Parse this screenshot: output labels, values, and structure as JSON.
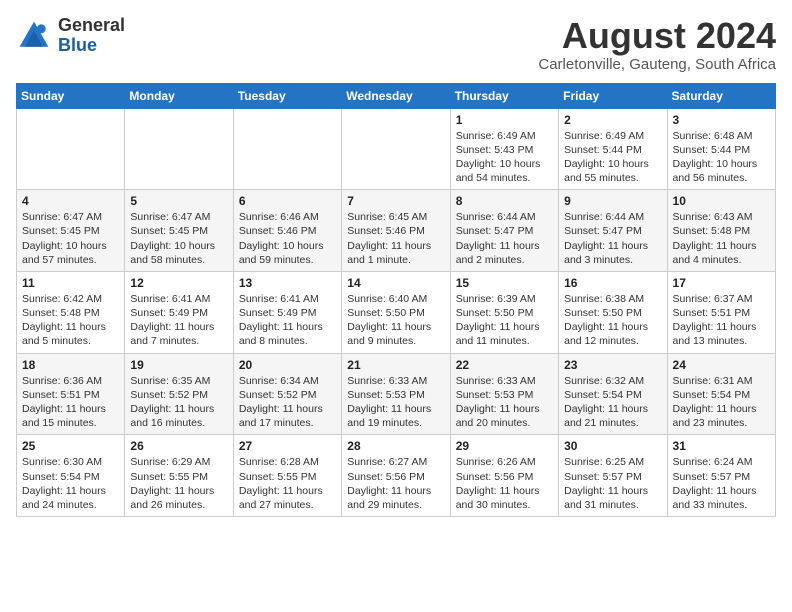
{
  "header": {
    "logo_general": "General",
    "logo_blue": "Blue",
    "month_title": "August 2024",
    "subtitle": "Carletonville, Gauteng, South Africa"
  },
  "days_of_week": [
    "Sunday",
    "Monday",
    "Tuesday",
    "Wednesday",
    "Thursday",
    "Friday",
    "Saturday"
  ],
  "weeks": [
    [
      {
        "day": "",
        "info": ""
      },
      {
        "day": "",
        "info": ""
      },
      {
        "day": "",
        "info": ""
      },
      {
        "day": "",
        "info": ""
      },
      {
        "day": "1",
        "info": "Sunrise: 6:49 AM\nSunset: 5:43 PM\nDaylight: 10 hours and 54 minutes."
      },
      {
        "day": "2",
        "info": "Sunrise: 6:49 AM\nSunset: 5:44 PM\nDaylight: 10 hours and 55 minutes."
      },
      {
        "day": "3",
        "info": "Sunrise: 6:48 AM\nSunset: 5:44 PM\nDaylight: 10 hours and 56 minutes."
      }
    ],
    [
      {
        "day": "4",
        "info": "Sunrise: 6:47 AM\nSunset: 5:45 PM\nDaylight: 10 hours and 57 minutes."
      },
      {
        "day": "5",
        "info": "Sunrise: 6:47 AM\nSunset: 5:45 PM\nDaylight: 10 hours and 58 minutes."
      },
      {
        "day": "6",
        "info": "Sunrise: 6:46 AM\nSunset: 5:46 PM\nDaylight: 10 hours and 59 minutes."
      },
      {
        "day": "7",
        "info": "Sunrise: 6:45 AM\nSunset: 5:46 PM\nDaylight: 11 hours and 1 minute."
      },
      {
        "day": "8",
        "info": "Sunrise: 6:44 AM\nSunset: 5:47 PM\nDaylight: 11 hours and 2 minutes."
      },
      {
        "day": "9",
        "info": "Sunrise: 6:44 AM\nSunset: 5:47 PM\nDaylight: 11 hours and 3 minutes."
      },
      {
        "day": "10",
        "info": "Sunrise: 6:43 AM\nSunset: 5:48 PM\nDaylight: 11 hours and 4 minutes."
      }
    ],
    [
      {
        "day": "11",
        "info": "Sunrise: 6:42 AM\nSunset: 5:48 PM\nDaylight: 11 hours and 5 minutes."
      },
      {
        "day": "12",
        "info": "Sunrise: 6:41 AM\nSunset: 5:49 PM\nDaylight: 11 hours and 7 minutes."
      },
      {
        "day": "13",
        "info": "Sunrise: 6:41 AM\nSunset: 5:49 PM\nDaylight: 11 hours and 8 minutes."
      },
      {
        "day": "14",
        "info": "Sunrise: 6:40 AM\nSunset: 5:50 PM\nDaylight: 11 hours and 9 minutes."
      },
      {
        "day": "15",
        "info": "Sunrise: 6:39 AM\nSunset: 5:50 PM\nDaylight: 11 hours and 11 minutes."
      },
      {
        "day": "16",
        "info": "Sunrise: 6:38 AM\nSunset: 5:50 PM\nDaylight: 11 hours and 12 minutes."
      },
      {
        "day": "17",
        "info": "Sunrise: 6:37 AM\nSunset: 5:51 PM\nDaylight: 11 hours and 13 minutes."
      }
    ],
    [
      {
        "day": "18",
        "info": "Sunrise: 6:36 AM\nSunset: 5:51 PM\nDaylight: 11 hours and 15 minutes."
      },
      {
        "day": "19",
        "info": "Sunrise: 6:35 AM\nSunset: 5:52 PM\nDaylight: 11 hours and 16 minutes."
      },
      {
        "day": "20",
        "info": "Sunrise: 6:34 AM\nSunset: 5:52 PM\nDaylight: 11 hours and 17 minutes."
      },
      {
        "day": "21",
        "info": "Sunrise: 6:33 AM\nSunset: 5:53 PM\nDaylight: 11 hours and 19 minutes."
      },
      {
        "day": "22",
        "info": "Sunrise: 6:33 AM\nSunset: 5:53 PM\nDaylight: 11 hours and 20 minutes."
      },
      {
        "day": "23",
        "info": "Sunrise: 6:32 AM\nSunset: 5:54 PM\nDaylight: 11 hours and 21 minutes."
      },
      {
        "day": "24",
        "info": "Sunrise: 6:31 AM\nSunset: 5:54 PM\nDaylight: 11 hours and 23 minutes."
      }
    ],
    [
      {
        "day": "25",
        "info": "Sunrise: 6:30 AM\nSunset: 5:54 PM\nDaylight: 11 hours and 24 minutes."
      },
      {
        "day": "26",
        "info": "Sunrise: 6:29 AM\nSunset: 5:55 PM\nDaylight: 11 hours and 26 minutes."
      },
      {
        "day": "27",
        "info": "Sunrise: 6:28 AM\nSunset: 5:55 PM\nDaylight: 11 hours and 27 minutes."
      },
      {
        "day": "28",
        "info": "Sunrise: 6:27 AM\nSunset: 5:56 PM\nDaylight: 11 hours and 29 minutes."
      },
      {
        "day": "29",
        "info": "Sunrise: 6:26 AM\nSunset: 5:56 PM\nDaylight: 11 hours and 30 minutes."
      },
      {
        "day": "30",
        "info": "Sunrise: 6:25 AM\nSunset: 5:57 PM\nDaylight: 11 hours and 31 minutes."
      },
      {
        "day": "31",
        "info": "Sunrise: 6:24 AM\nSunset: 5:57 PM\nDaylight: 11 hours and 33 minutes."
      }
    ]
  ]
}
